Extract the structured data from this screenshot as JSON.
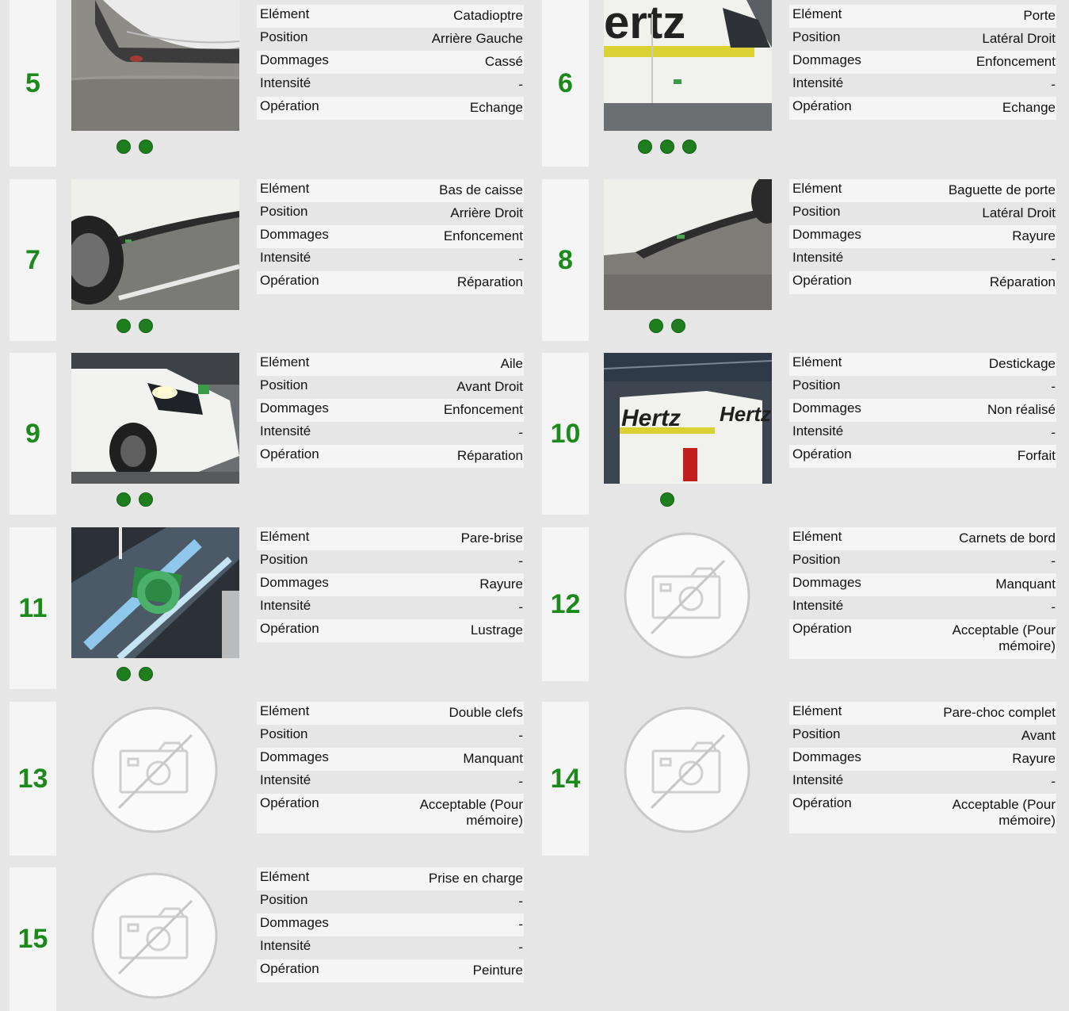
{
  "labels": {
    "element": "Elément",
    "position": "Position",
    "dommages": "Dommages",
    "intensite": "Intensité",
    "operation": "Opération"
  },
  "colors": {
    "accent_green": "#1b8a1b",
    "dot_green": "#1e7e1e"
  },
  "cards": [
    {
      "num": "5",
      "element": "Catadioptre",
      "position": "Arrière Gauche",
      "dommages": "Cassé",
      "intensite": "-",
      "operation": "Echange",
      "photo": "rear-corner-photo",
      "dots": 2
    },
    {
      "num": "6",
      "element": "Porte",
      "position": "Latéral Droit",
      "dommages": "Enfoncement",
      "intensite": "-",
      "operation": "Echange",
      "photo": "side-door-photo",
      "dots": 3
    },
    {
      "num": "7",
      "element": "Bas de caisse",
      "position": "Arrière Droit",
      "dommages": "Enfoncement",
      "intensite": "-",
      "operation": "Réparation",
      "photo": "sill-photo",
      "dots": 2
    },
    {
      "num": "8",
      "element": "Baguette de porte",
      "position": "Latéral Droit",
      "dommages": "Rayure",
      "intensite": "-",
      "operation": "Réparation",
      "photo": "door-strip-photo",
      "dots": 2
    },
    {
      "num": "9",
      "element": "Aile",
      "position": "Avant Droit",
      "dommages": "Enfoncement",
      "intensite": "-",
      "operation": "Réparation",
      "photo": "front-wing-photo",
      "dots": 2
    },
    {
      "num": "10",
      "element": "Destickage",
      "position": "-",
      "dommages": "Non réalisé",
      "intensite": "-",
      "operation": "Forfait",
      "photo": "hertz-van-photo",
      "dots": 1
    },
    {
      "num": "11",
      "element": "Pare-brise",
      "position": "-",
      "dommages": "Rayure",
      "intensite": "-",
      "operation": "Lustrage",
      "photo": "windshield-photo",
      "dots": 2
    },
    {
      "num": "12",
      "element": "Carnets de bord",
      "position": "-",
      "dommages": "Manquant",
      "intensite": "-",
      "operation": "Acceptable (Pour mémoire)",
      "photo": "no-photo",
      "dots": 0
    },
    {
      "num": "13",
      "element": "Double clefs",
      "position": "-",
      "dommages": "Manquant",
      "intensite": "-",
      "operation": "Acceptable (Pour mémoire)",
      "photo": "no-photo",
      "dots": 0
    },
    {
      "num": "14",
      "element": "Pare-choc complet",
      "position": "Avant",
      "dommages": "Rayure",
      "intensite": "-",
      "operation": "Acceptable (Pour mémoire)",
      "photo": "no-photo",
      "dots": 0
    },
    {
      "num": "15",
      "element": "Prise en charge",
      "position": "-",
      "dommages": "-",
      "intensite": "-",
      "operation": "Peinture",
      "photo": "no-photo",
      "dots": 0
    }
  ]
}
